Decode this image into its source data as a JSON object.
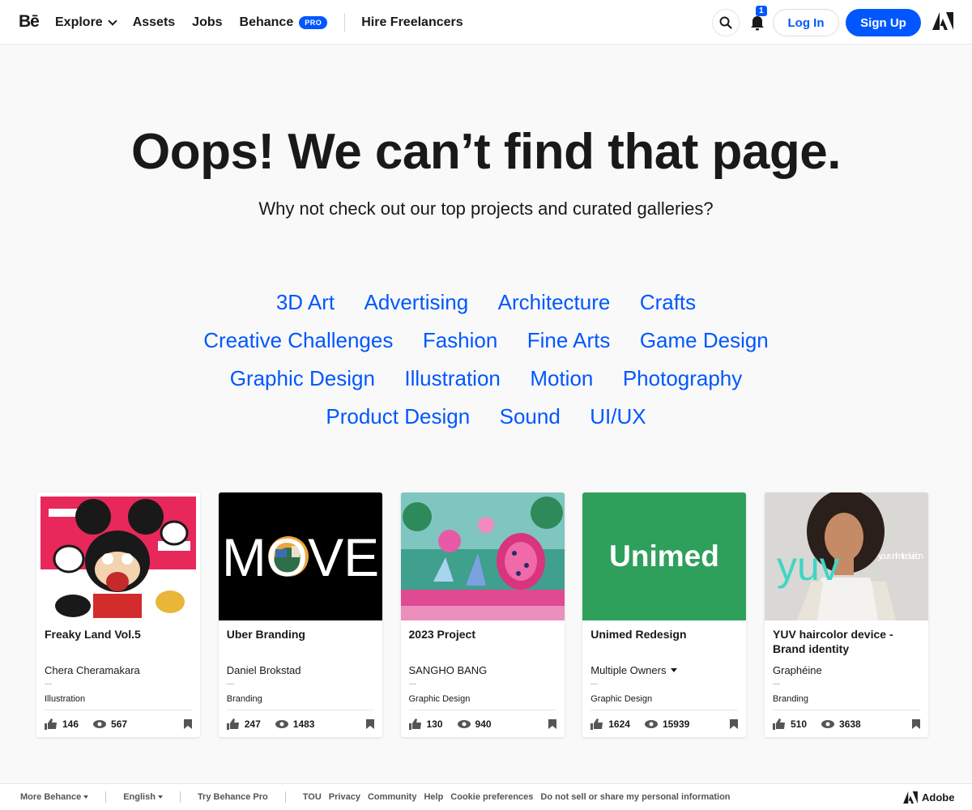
{
  "header": {
    "logo": "Bē",
    "nav": {
      "explore": "Explore",
      "assets": "Assets",
      "jobs": "Jobs",
      "behance": "Behance",
      "pro_badge": "PRO",
      "hire": "Hire Freelancers"
    },
    "notification_count": "1",
    "login_label": "Log In",
    "signup_label": "Sign Up"
  },
  "hero": {
    "title": "Oops! We can’t find that page.",
    "subtitle": "Why not check out our top projects and curated galleries?"
  },
  "categories": [
    "3D Art",
    "Advertising",
    "Architecture",
    "Crafts",
    "Creative Challenges",
    "Fashion",
    "Fine Arts",
    "Game Design",
    "Graphic Design",
    "Illustration",
    "Motion",
    "Photography",
    "Product Design",
    "Sound",
    "UI/UX"
  ],
  "cards": [
    {
      "title": "Freaky Land Vol.5",
      "owner": "Chera Cheramakara",
      "field": "Illustration",
      "likes": "146",
      "views": "567",
      "thumb_text": ""
    },
    {
      "title": "Uber Branding",
      "owner": "Daniel Brokstad",
      "field": "Branding",
      "likes": "247",
      "views": "1483",
      "thumb_text": "MOVE"
    },
    {
      "title": "2023 Project",
      "owner": "SANGHO BANG",
      "field": "Graphic Design",
      "likes": "130",
      "views": "940",
      "thumb_text": ""
    },
    {
      "title": "Unimed Redesign",
      "owner": "Multiple Owners",
      "field": "Graphic Design",
      "likes": "1624",
      "views": "15939",
      "thumb_text": "Unimed"
    },
    {
      "title": "YUV haircolor device -Brand identity",
      "owner": "Graphéine",
      "field": "Branding",
      "likes": "510",
      "views": "3638",
      "thumb_text": "yuv",
      "thumb_sub": "your unlimited vision"
    }
  ],
  "footer": {
    "more": "More Behance",
    "language": "English",
    "try_pro": "Try Behance Pro",
    "links": [
      "TOU",
      "Privacy",
      "Community",
      "Help",
      "Cookie preferences",
      "Do not sell or share my personal information"
    ],
    "adobe": "Adobe"
  },
  "colors": {
    "accent": "#0057ff",
    "text": "#191919",
    "background": "#f9f9f9"
  }
}
